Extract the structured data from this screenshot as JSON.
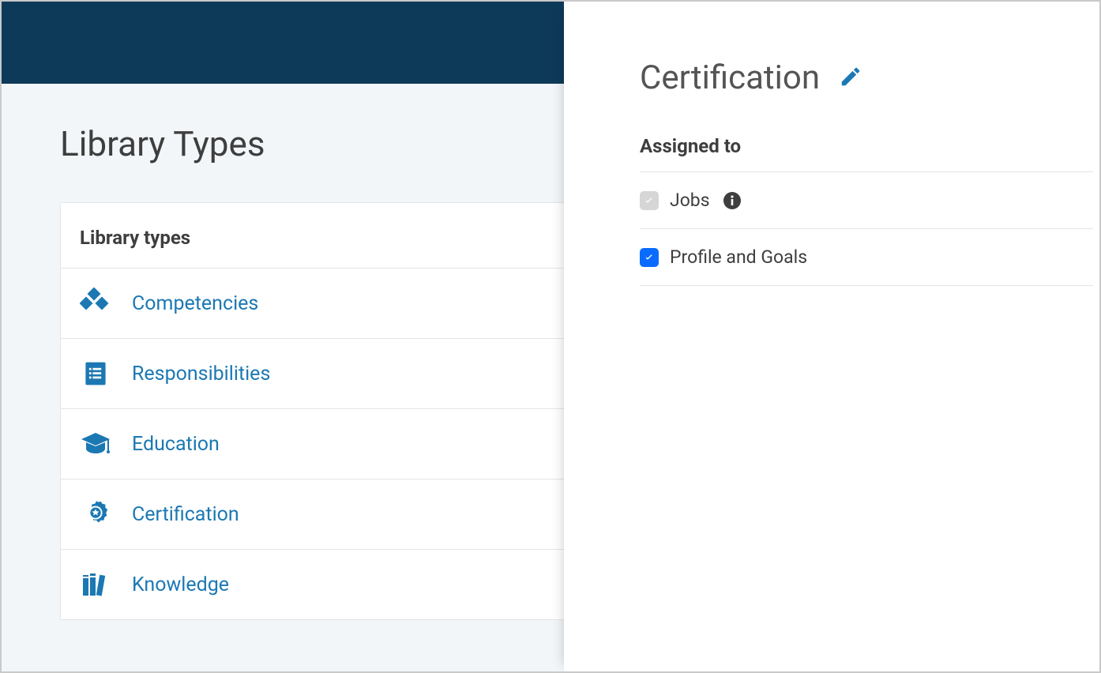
{
  "page": {
    "title": "Library Types"
  },
  "card": {
    "heading": "Library types",
    "items": [
      {
        "label": "Competencies",
        "icon": "diamonds"
      },
      {
        "label": "Responsibilities",
        "icon": "clipboard"
      },
      {
        "label": "Education",
        "icon": "gradcap"
      },
      {
        "label": "Certification",
        "icon": "badge"
      },
      {
        "label": "Knowledge",
        "icon": "books"
      }
    ]
  },
  "detail": {
    "title": "Certification",
    "section_heading": "Assigned to",
    "assignments": [
      {
        "label": "Jobs",
        "checked": true,
        "disabled": true,
        "info": true
      },
      {
        "label": "Profile and Goals",
        "checked": true,
        "disabled": false,
        "info": false
      }
    ]
  },
  "colors": {
    "header_bg": "#0e3a5a",
    "link": "#1b78b3",
    "accent_blue": "#0a6cff",
    "panel_bg": "#f2f6f9"
  }
}
